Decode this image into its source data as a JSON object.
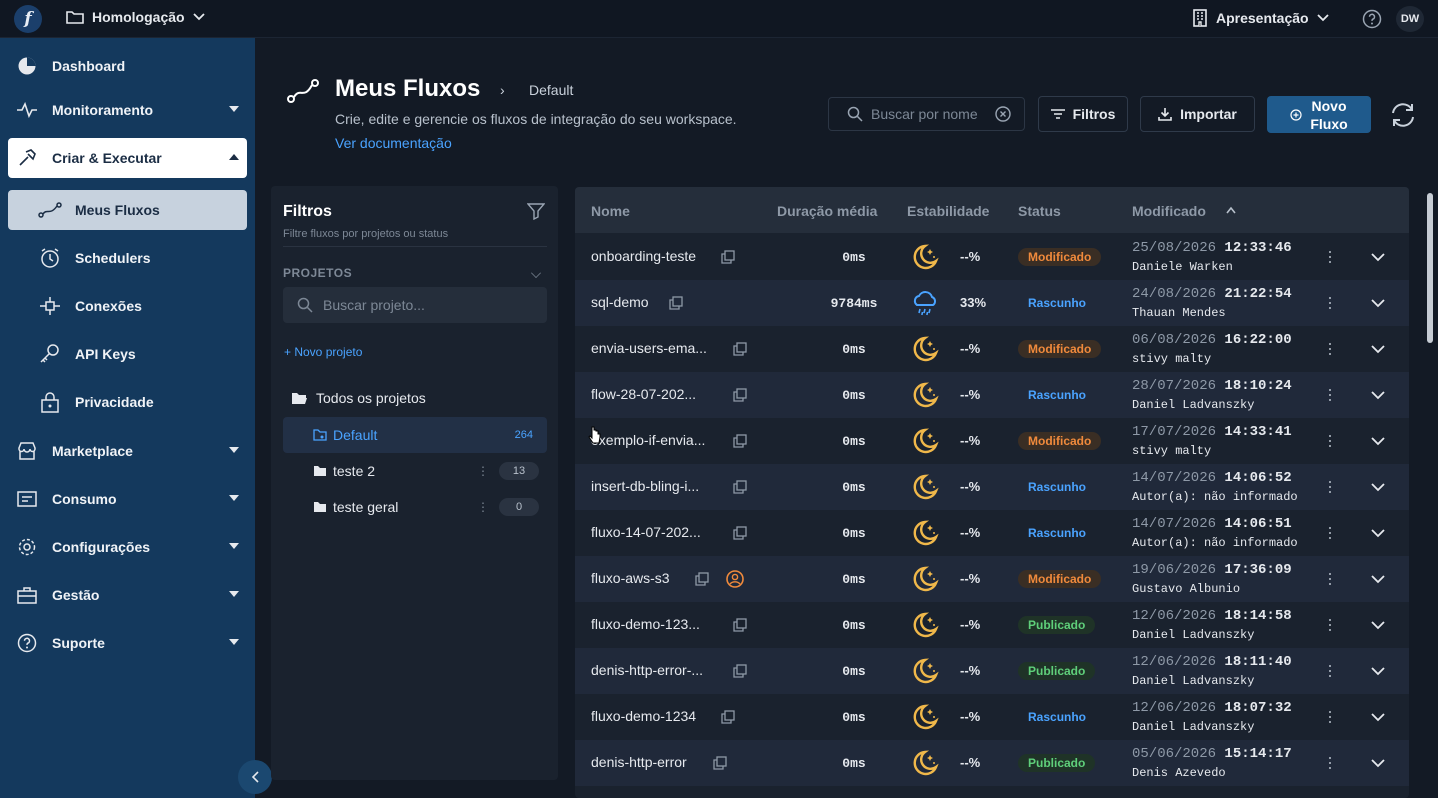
{
  "topbar": {
    "logo_letter": "f",
    "environment": "Homologação",
    "organization": "Apresentação",
    "user_initials": "DW"
  },
  "sidebar": {
    "items": [
      {
        "label": "Dashboard",
        "icon": "dashboard-icon"
      },
      {
        "label": "Monitoramento",
        "icon": "pulse-icon"
      },
      {
        "label": "Criar & Executar",
        "icon": "hammer-icon"
      },
      {
        "label": "Marketplace",
        "icon": "store-icon"
      },
      {
        "label": "Consumo",
        "icon": "receipt-icon"
      },
      {
        "label": "Configurações",
        "icon": "gear-icon"
      },
      {
        "label": "Gestão",
        "icon": "briefcase-icon"
      },
      {
        "label": "Suporte",
        "icon": "help-icon"
      }
    ],
    "sub_items": [
      {
        "label": "Meus Fluxos",
        "icon": "flow-icon"
      },
      {
        "label": "Schedulers",
        "icon": "clock-icon"
      },
      {
        "label": "Conexões",
        "icon": "connection-icon"
      },
      {
        "label": "API Keys",
        "icon": "key-icon"
      },
      {
        "label": "Privacidade",
        "icon": "lock-icon"
      }
    ]
  },
  "header": {
    "title": "Meus Fluxos",
    "breadcrumb_separator": "›",
    "breadcrumb": "Default",
    "subtitle": "Crie, edite e gerencie os fluxos de integração do seu workspace.",
    "doc_link": "Ver documentação",
    "search_placeholder": "Buscar por nome",
    "filters_label": "Filtros",
    "import_label": "Importar",
    "new_label_line1": "Novo",
    "new_label_line2": "Fluxo"
  },
  "filters": {
    "title": "Filtros",
    "subtitle": "Filtre fluxos por projetos ou status",
    "section": "PROJETOS",
    "project_search_placeholder": "Buscar projeto...",
    "new_project": "+ Novo projeto",
    "all_projects": "Todos os projetos",
    "projects": [
      {
        "name": "Default",
        "count": "264"
      },
      {
        "name": "teste 2",
        "count": "13"
      },
      {
        "name": "teste geral",
        "count": "0"
      }
    ]
  },
  "table": {
    "headers": {
      "name": "Nome",
      "duration": "Duração média",
      "stability": "Estabilidade",
      "status": "Status",
      "modified": "Modificado"
    },
    "rows": [
      {
        "name": "onboarding-teste",
        "duration": "0ms",
        "weather": "moon",
        "stability": "--%",
        "status": "Modificado",
        "date": "25/08/2026",
        "time": "12:33:46",
        "author": "Daniele Warken"
      },
      {
        "name": "sql-demo",
        "duration": "9784ms",
        "weather": "rain",
        "stability": "33%",
        "status": "Rascunho",
        "date": "24/08/2026",
        "time": "21:22:54",
        "author": "Thauan Mendes"
      },
      {
        "name": "envia-users-ema...",
        "duration": "0ms",
        "weather": "moon",
        "stability": "--%",
        "status": "Modificado",
        "date": "06/08/2026",
        "time": "16:22:00",
        "author": "stivy malty"
      },
      {
        "name": "flow-28-07-202...",
        "duration": "0ms",
        "weather": "moon",
        "stability": "--%",
        "status": "Rascunho",
        "date": "28/07/2026",
        "time": "18:10:24",
        "author": "Daniel Ladvanszky"
      },
      {
        "name": "exemplo-if-envia...",
        "duration": "0ms",
        "weather": "moon",
        "stability": "--%",
        "status": "Modificado",
        "date": "17/07/2026",
        "time": "14:33:41",
        "author": "stivy malty"
      },
      {
        "name": "insert-db-bling-i...",
        "duration": "0ms",
        "weather": "moon",
        "stability": "--%",
        "status": "Rascunho",
        "date": "14/07/2026",
        "time": "14:06:52",
        "author": "Autor(a): não informado"
      },
      {
        "name": "fluxo-14-07-202...",
        "duration": "0ms",
        "weather": "moon",
        "stability": "--%",
        "status": "Rascunho",
        "date": "14/07/2026",
        "time": "14:06:51",
        "author": "Autor(a): não informado"
      },
      {
        "name": "fluxo-aws-s3",
        "duration": "0ms",
        "weather": "moon",
        "stability": "--%",
        "status": "Modificado",
        "date": "19/06/2026",
        "time": "17:36:09",
        "author": "Gustavo Albunio"
      },
      {
        "name": "fluxo-demo-123...",
        "duration": "0ms",
        "weather": "moon",
        "stability": "--%",
        "status": "Publicado",
        "date": "12/06/2026",
        "time": "18:14:58",
        "author": "Daniel Ladvanszky"
      },
      {
        "name": "denis-http-error-...",
        "duration": "0ms",
        "weather": "moon",
        "stability": "--%",
        "status": "Publicado",
        "date": "12/06/2026",
        "time": "18:11:40",
        "author": "Daniel Ladvanszky"
      },
      {
        "name": "fluxo-demo-1234",
        "duration": "0ms",
        "weather": "moon",
        "stability": "--%",
        "status": "Rascunho",
        "date": "12/06/2026",
        "time": "18:07:32",
        "author": "Daniel Ladvanszky"
      },
      {
        "name": "denis-http-error",
        "duration": "0ms",
        "weather": "moon",
        "stability": "--%",
        "status": "Publicado",
        "date": "05/06/2026",
        "time": "15:14:17",
        "author": "Denis Azevedo"
      }
    ]
  },
  "colors": {
    "accent": "#4aa3ff",
    "sidebar": "#14395d",
    "modified": "#f08a3c",
    "published": "#5fcf7a",
    "moon": "#f0b84a"
  }
}
